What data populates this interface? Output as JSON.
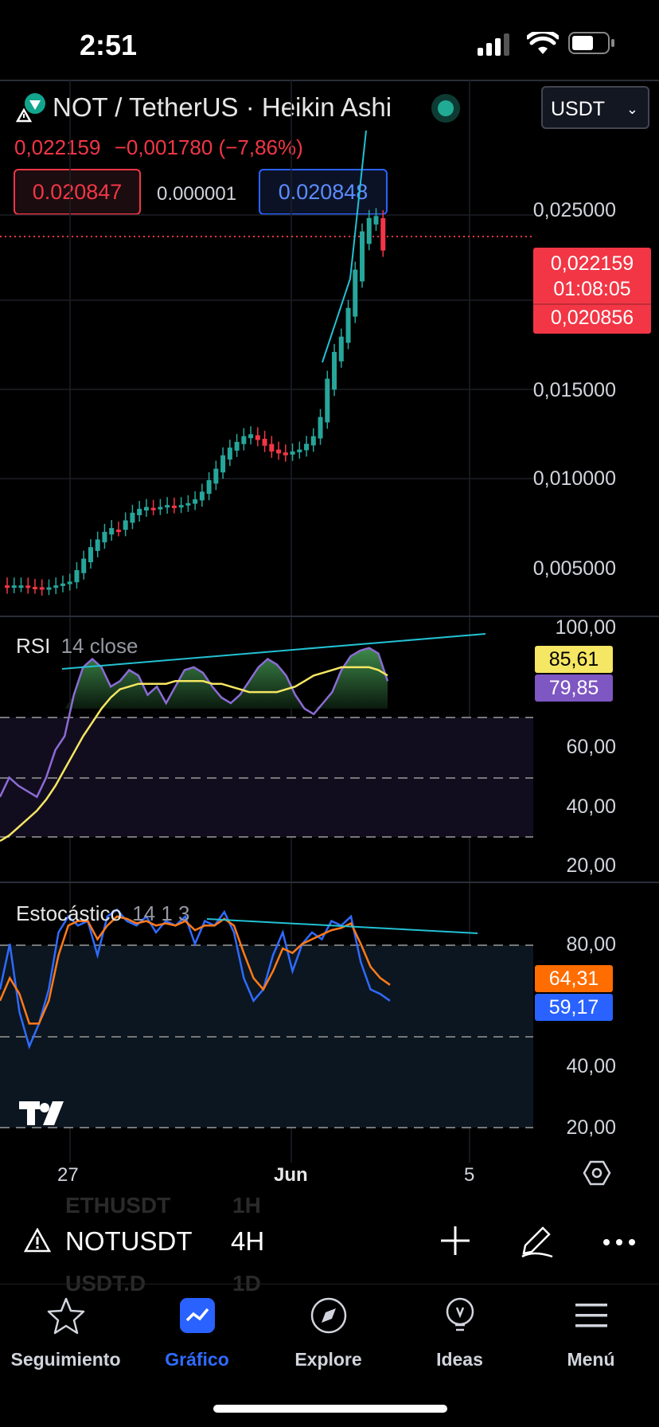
{
  "status_bar": {
    "time": "2:51"
  },
  "header": {
    "title": "NOT / TetherUS · Heikin Ashi",
    "last_price": "0,022159",
    "change": "−0,001780 (−7,86%)",
    "bid": "0.020847",
    "spread": "0.000001",
    "ask": "0.020848",
    "currency": "USDT"
  },
  "price_axis": {
    "labels": [
      "0,025000",
      "0,015000",
      "0,010000",
      "0,005000"
    ],
    "last_price_tag": "0,022159",
    "countdown": "01:08:05",
    "bid_tag": "0,020856"
  },
  "rsi": {
    "title": "RSI",
    "params": "14 close",
    "axis": [
      "100,00",
      "60,00",
      "40,00",
      "20,00"
    ],
    "value": "85,61",
    "ma_value": "79,85"
  },
  "stoch": {
    "title": "Estocástico",
    "params": "14 1 3",
    "axis": [
      "80,00",
      "40,00",
      "20,00"
    ],
    "k_value": "64,31",
    "d_value": "59,17"
  },
  "time_axis": {
    "labels": [
      "27",
      "Jun",
      "5"
    ]
  },
  "toolbar": {
    "symbol": "NOTUSDT",
    "interval": "4H",
    "ghost_top": "ETHUSDT",
    "ghost_top_interval": "1H",
    "ghost_bottom": "USDT.D",
    "ghost_bottom_interval": "1D"
  },
  "tabs": [
    {
      "label": "Seguimiento",
      "icon": "star-icon"
    },
    {
      "label": "Gráfico",
      "icon": "chart-icon"
    },
    {
      "label": "Explore",
      "icon": "compass-icon"
    },
    {
      "label": "Ideas",
      "icon": "lightbulb-icon"
    },
    {
      "label": "Menú",
      "icon": "menu-icon"
    }
  ],
  "colors": {
    "up": "#26a69a",
    "down": "#f23645",
    "accent": "#2962ff",
    "rsi": "#7e57c2",
    "rsi_ma": "#f5e663",
    "stoch_k": "#2962ff",
    "stoch_d": "#ff6d00"
  }
}
